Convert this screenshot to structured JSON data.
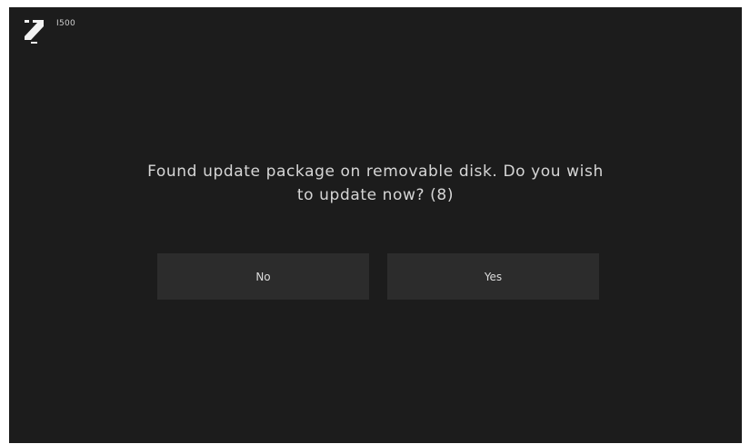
{
  "header": {
    "model": "I500",
    "logo_icon": "brand-logo-icon"
  },
  "dialog": {
    "message": "Found update package on removable disk. Do you wish to update now? (8)",
    "no_label": "No",
    "yes_label": "Yes"
  },
  "colors": {
    "background": "#1c1c1c",
    "button": "#2c2c2c",
    "text": "#d6d6d6"
  }
}
